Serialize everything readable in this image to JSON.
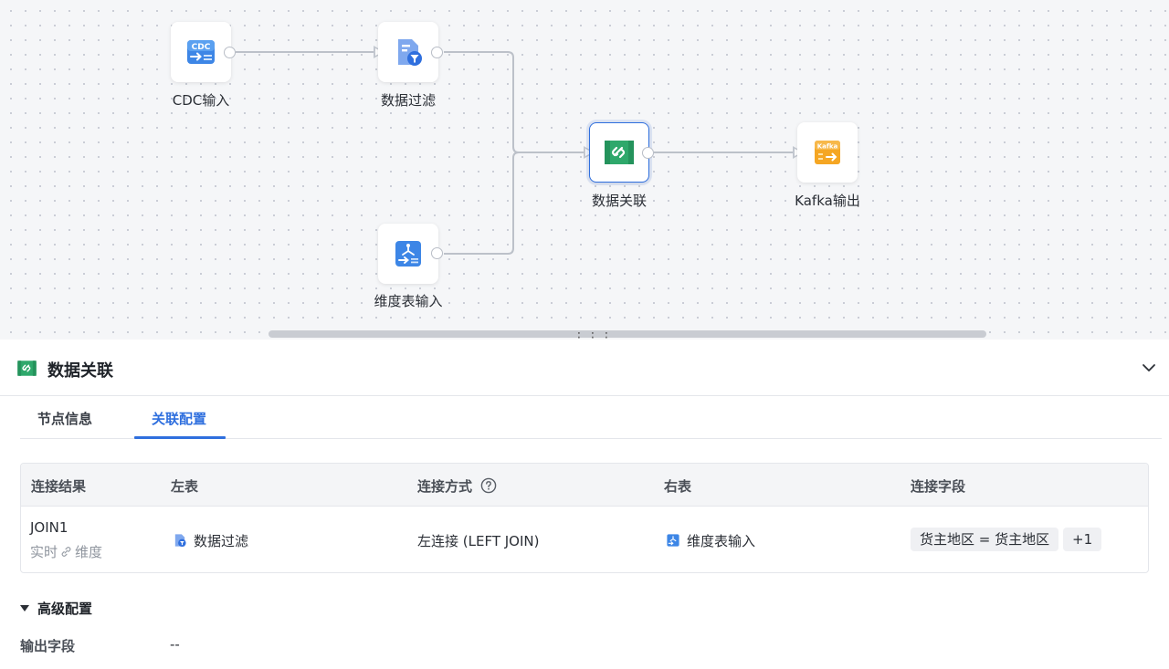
{
  "canvas": {
    "nodes": [
      {
        "id": "cdc",
        "label": "CDC输入",
        "icon": "cdc-input-icon",
        "icon_text": "CDC"
      },
      {
        "id": "filter",
        "label": "数据过滤",
        "icon": "data-filter-icon"
      },
      {
        "id": "join",
        "label": "数据关联",
        "icon": "data-join-icon",
        "selected": true
      },
      {
        "id": "kafka",
        "label": "Kafka输出",
        "icon": "kafka-output-icon",
        "icon_text": "Kafka"
      },
      {
        "id": "dim",
        "label": "维度表输入",
        "icon": "dimension-table-input-icon"
      }
    ],
    "edges": [
      {
        "from": "cdc",
        "to": "filter"
      },
      {
        "from": "filter",
        "to": "join"
      },
      {
        "from": "dim",
        "to": "join"
      },
      {
        "from": "join",
        "to": "kafka"
      }
    ]
  },
  "panel": {
    "title": "数据关联",
    "icon": "data-join-icon",
    "collapse_icon": "chevron-down-icon",
    "tabs": [
      {
        "label": "节点信息",
        "active": false
      },
      {
        "label": "关联配置",
        "active": true
      }
    ],
    "table": {
      "headers": {
        "result": "连接结果",
        "left": "左表",
        "join_type": "连接方式",
        "right": "右表",
        "fields": "连接字段"
      },
      "rows": [
        {
          "result": "JOIN1",
          "result_sub_left": "实时",
          "result_sub_right": "维度",
          "left": "数据过滤",
          "join_type": "左连接 (LEFT JOIN)",
          "right": "维度表输入",
          "field": "货主地区 = 货主地区",
          "more": "+1"
        }
      ]
    },
    "advanced": {
      "label": "高级配置",
      "expanded": true,
      "output_fields_label": "输出字段",
      "output_fields_value": "--"
    }
  },
  "colors": {
    "accent": "#2f6fde",
    "join_green": "#2ea86b",
    "kafka_orange": "#f5a623",
    "icon_blue": "#3d86e6"
  }
}
